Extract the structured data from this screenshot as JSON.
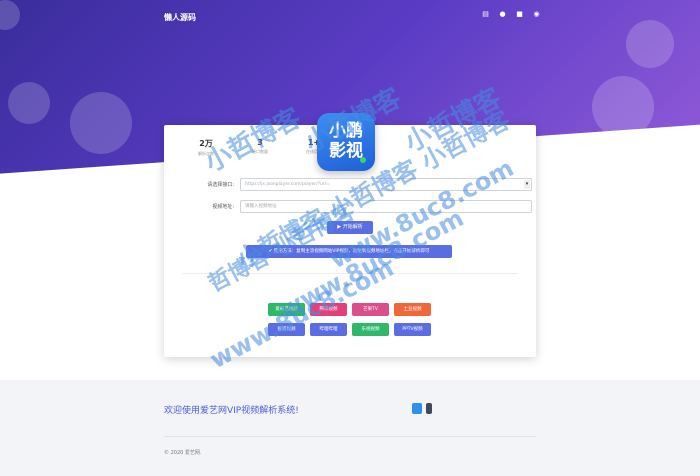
{
  "header": {
    "brand": "懒人源码",
    "icons": [
      "cart-icon",
      "user-icon",
      "grid-icon",
      "settings-icon"
    ]
  },
  "card": {
    "stats": [
      {
        "value": "2万",
        "label": "解析次数"
      },
      {
        "value": "3",
        "label": "接口数量"
      },
      {
        "value": "1+",
        "label": "在线用户"
      }
    ],
    "logo_text": [
      "小鹏",
      "影视"
    ],
    "form": {
      "interface_label": "请选择接口:",
      "interface_value": "https://jx.jsonplayer.com/player/?url=",
      "url_label": "视频地址:",
      "url_placeholder": "请输入视频地址"
    },
    "parse_button": "开始解析",
    "tip": "使用方法：复制主流视频网站VIP视频，粘贴到视频地址栏，点击开始解析即可",
    "platforms": [
      {
        "label": "爱奇艺视频",
        "color": "#2fb86a"
      },
      {
        "label": "腾讯视频",
        "color": "#e2407a"
      },
      {
        "label": "芒果TV",
        "color": "#d94f8c"
      },
      {
        "label": "土豆视频",
        "color": "#f0683a"
      },
      {
        "label": "搜狐视频",
        "color": "#5b6ee1"
      },
      {
        "label": "哔哩哔哩",
        "color": "#5b6ee1"
      },
      {
        "label": "乐视视频",
        "color": "#2fb86a"
      },
      {
        "label": "PPTV视频",
        "color": "#5b6ee1"
      }
    ]
  },
  "footer": {
    "welcome": "欢迎使用爱艺网VIP视频解析系统!",
    "copyright": "© 2020 爱艺网."
  },
  "watermarks": [
    "小哲博客",
    "小哲博客",
    "小哲博客",
    "小哲博客 小哲博客 小哲博客",
    "www.8uc8.com",
    "www.8uc8.com",
    "www.8uc8.com",
    "哲博客 小哲博客"
  ]
}
